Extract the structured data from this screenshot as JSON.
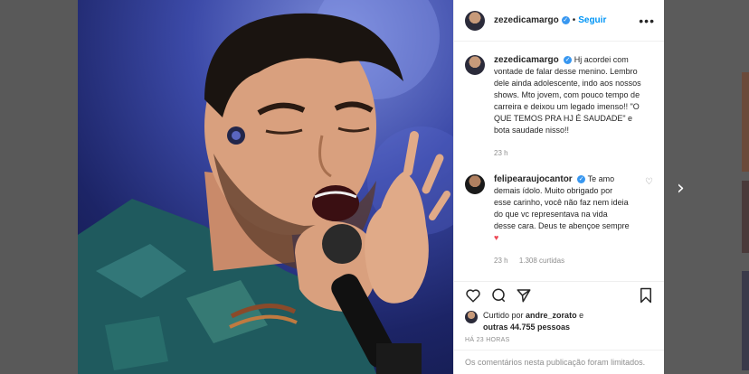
{
  "post": {
    "author": "zezedicamargo",
    "verified_mark": "✓",
    "separator": "•",
    "follow_label": "Seguir",
    "more_label": "•••"
  },
  "caption": {
    "author": "zezedicamargo",
    "text": "Hj acordei com vontade de falar desse menino. Lembro dele ainda adolescente, indo aos nossos shows. Mto jovem, com pouco tempo de carreira e deixou um legado imenso!! \"O QUE TEMOS PRA HJ É SAUDADE\" e bota saudade nisso!!",
    "time": "23 h"
  },
  "comment": {
    "author": "felipearaujocantor",
    "text": "Te amo demais ídolo. Muito obrigado por esse carinho, você não faz nem ideia do que vc representava na vida desse cara. Deus te abençoe sempre",
    "emoji": "♥",
    "time": "23 h",
    "likes": "1.308 curtidas",
    "like_icon": "heart-outline-icon"
  },
  "likes": {
    "prefix": "Curtido por",
    "user": "andre_zorato",
    "connector": "e",
    "others": "outras 44.755 pessoas"
  },
  "timestamp": "HÁ 23 HORAS",
  "comments_limited": "Os comentários nesta publicação foram limitados.",
  "nav": {
    "next": "›"
  },
  "colors": {
    "accent": "#0095f6",
    "verified": "#3897f0",
    "heart": "#ed4956"
  }
}
